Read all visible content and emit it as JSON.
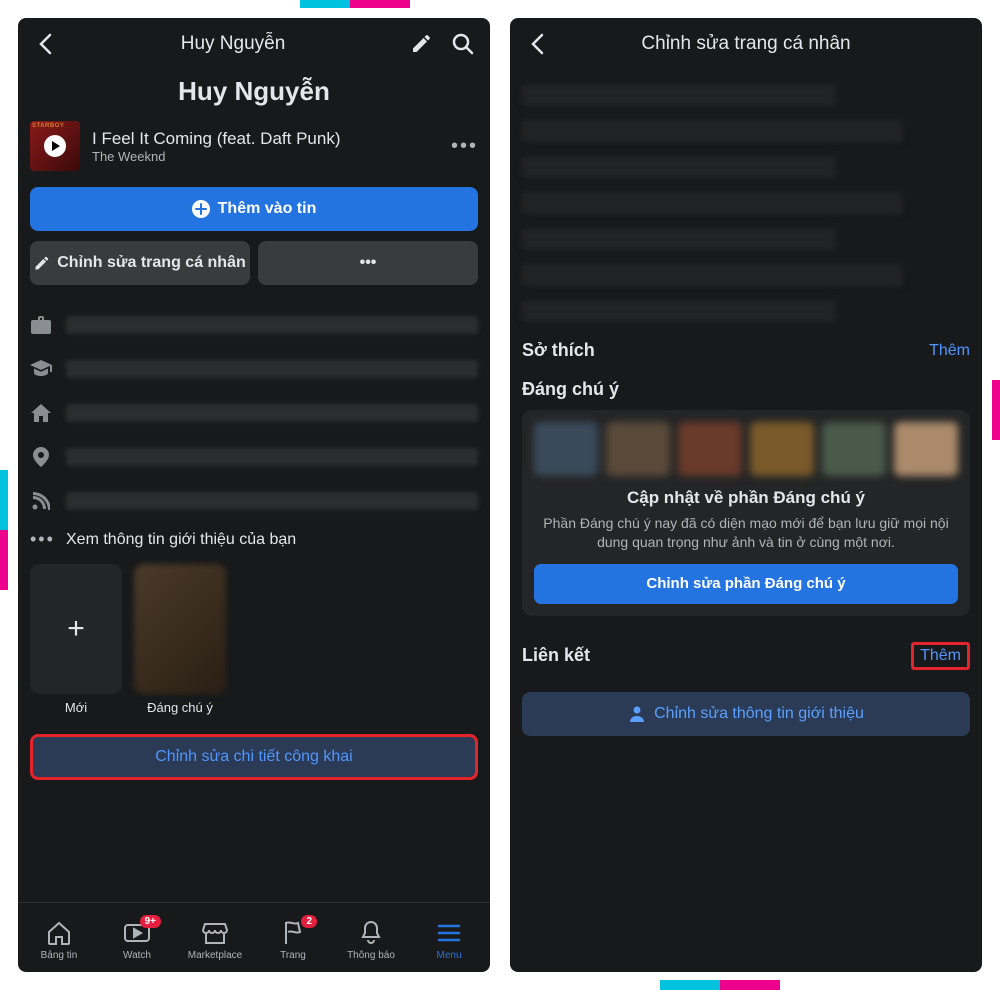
{
  "screen1": {
    "header_title": "Huy Nguyễn",
    "profile_name": "Huy Nguyễn",
    "music": {
      "cover_tag": "STARBOY",
      "title": "I Feel It Coming (feat. Daft Punk)",
      "artist": "The Weeknd"
    },
    "btn_add_story": "Thêm vào tin",
    "btn_edit_profile": "Chỉnh sửa trang cá nhân",
    "see_about": "Xem thông tin giới thiệu của bạn",
    "story_new": "Mới",
    "story_highlight": "Đáng chú ý",
    "btn_edit_public": "Chỉnh sửa chi tiết công khai",
    "tabs": {
      "feed": "Bảng tin",
      "watch": "Watch",
      "market": "Marketplace",
      "pages": "Trang",
      "notif": "Thông báo",
      "menu": "Menu",
      "watch_badge": "9+",
      "pages_badge": "2"
    }
  },
  "screen2": {
    "header_title": "Chỉnh sửa trang cá nhân",
    "sec_hobby": "Sở thích",
    "sec_hobby_link": "Thêm",
    "sec_featured": "Đáng chú ý",
    "card_title": "Cập nhật về phần Đáng chú ý",
    "card_desc": "Phần Đáng chú ý nay đã có diện mạo mới để bạn lưu giữ mọi nội dung quan trọng như ảnh và tin ở cùng một nơi.",
    "card_btn": "Chỉnh sửa phần Đáng chú ý",
    "sec_links": "Liên kết",
    "sec_links_link": "Thêm",
    "btn_edit_about": "Chỉnh sửa thông tin giới thiệu"
  }
}
